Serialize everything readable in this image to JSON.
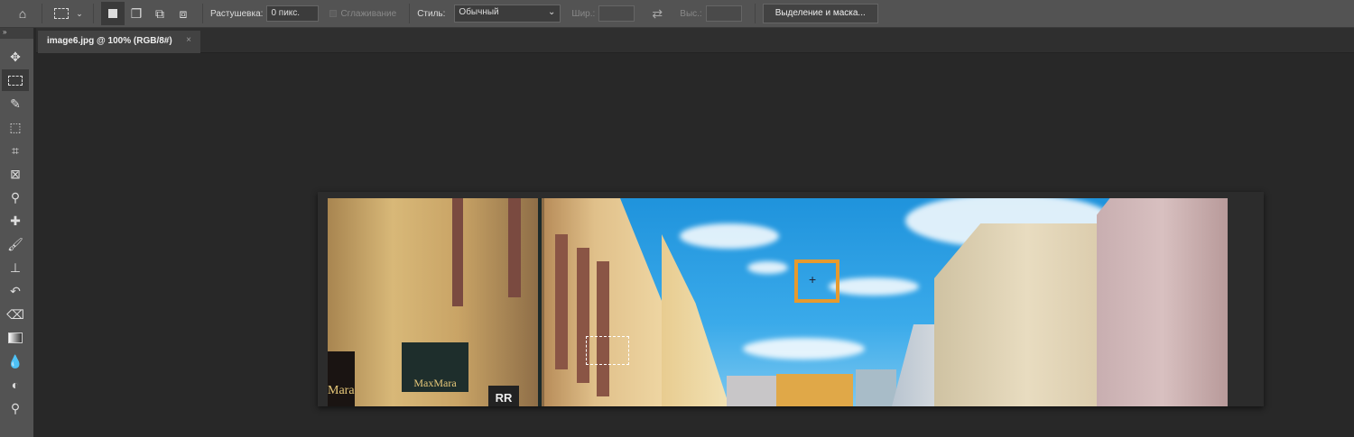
{
  "options_bar": {
    "home_icon": "home-icon",
    "feather_label": "Растушевка:",
    "feather_value": "0 пикс.",
    "antialias_label": "Сглаживание",
    "style_label": "Стиль:",
    "style_value": "Обычный",
    "width_label": "Шир.:",
    "height_label": "Выс.:",
    "select_mask_label": "Выделение и маска..."
  },
  "document_tab": {
    "title": "image6.jpg @ 100% (RGB/8#)",
    "close": "×"
  },
  "toolbar": {
    "collapse": "»"
  },
  "photo": {
    "sign_text": "MaxMara",
    "sign2": "Mara",
    "sign3": "RR",
    "accent": "#e69a2e"
  }
}
